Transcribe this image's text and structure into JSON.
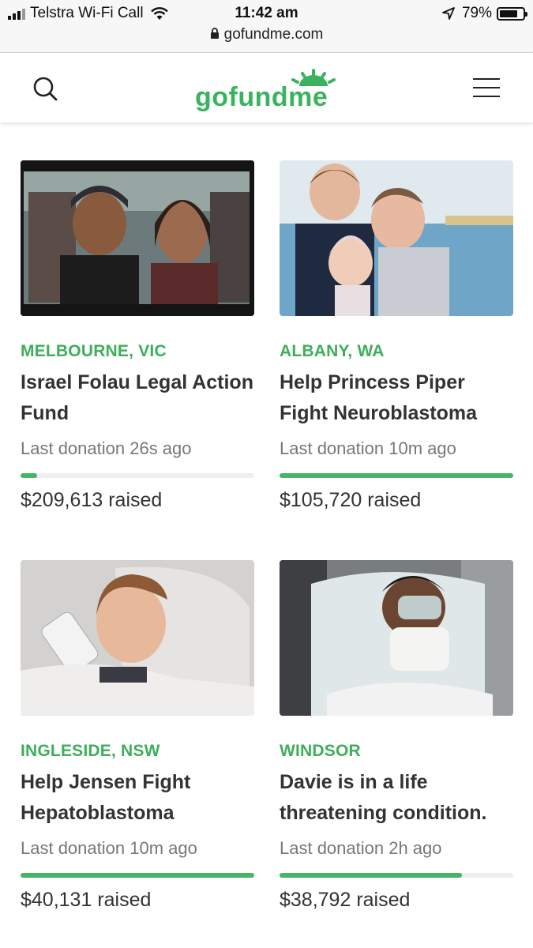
{
  "status_bar": {
    "carrier": "Telstra Wi-Fi Call",
    "time": "11:42 am",
    "battery": "79%",
    "battery_level": 0.79,
    "url": "gofundme.com"
  },
  "header": {
    "logo_text": "gofundme",
    "search_icon": "search-icon",
    "menu_icon": "hamburger-menu-icon"
  },
  "campaigns": [
    {
      "location": "MELBOURNE, VIC",
      "title": "Israel Folau Legal Action Fund",
      "last_donation": "Last donation 26s ago",
      "progress": 0.07,
      "raised": "$209,613 raised"
    },
    {
      "location": "ALBANY, WA",
      "title": "Help Princess Piper Fight Neuroblastoma",
      "last_donation": "Last donation 10m ago",
      "progress": 1.0,
      "raised": "$105,720 raised"
    },
    {
      "location": "INGLESIDE, NSW",
      "title": "Help Jensen Fight Hepatoblastoma",
      "last_donation": "Last donation 10m ago",
      "progress": 1.0,
      "raised": "$40,131 raised"
    },
    {
      "location": "WINDSOR",
      "title": "Davie is in a life threatening condition.",
      "last_donation": "Last donation 2h ago",
      "progress": 0.78,
      "raised": "$38,792 raised"
    }
  ],
  "colors": {
    "brand_green": "#3bb35e",
    "progress_green": "#47b565"
  }
}
